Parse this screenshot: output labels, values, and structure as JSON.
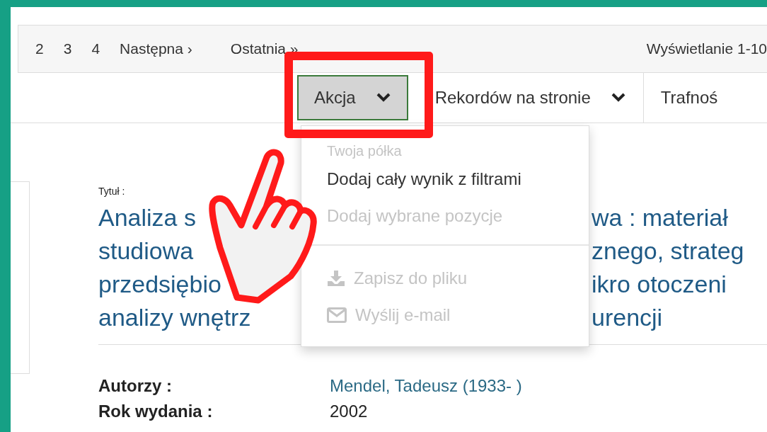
{
  "pagination": {
    "pages": [
      "2",
      "3",
      "4"
    ],
    "next": "Następna ›",
    "last": "Ostatnia »",
    "summary": "Wyświetlanie 1-10"
  },
  "toolbar": {
    "action": {
      "label": "Akcja",
      "expanded": true
    },
    "per_page": {
      "label": "Rekordów na stronie"
    },
    "sort": {
      "label": "Trafnoś"
    }
  },
  "action_menu": [
    {
      "kind": "header",
      "label": "Twoja półka",
      "disabled": true
    },
    {
      "kind": "item",
      "label": "Dodaj cały wynik z filtrami",
      "disabled": false
    },
    {
      "kind": "item",
      "label": "Dodaj wybrane pozycje",
      "disabled": true
    },
    {
      "kind": "divider"
    },
    {
      "kind": "download",
      "label": "Zapisz do pliku",
      "disabled": true
    },
    {
      "kind": "email",
      "label": "Wyślij e-mail",
      "disabled": true
    }
  ],
  "record": {
    "title_label": "Tytuł :",
    "title_lines": [
      [
        "Analiza s",
        "wa : materiał"
      ],
      [
        "studiowa",
        "znego, strateg"
      ],
      [
        "przedsiębio",
        "ikro otoczeni"
      ],
      [
        "analizy wnętrz",
        "urencji"
      ]
    ],
    "fields": [
      {
        "label": "Autorzy :",
        "value": "Mendel, Tadeusz (1933- )",
        "kind": "link"
      },
      {
        "label": "Rok wydania :",
        "value": "2002",
        "kind": "text"
      }
    ]
  }
}
